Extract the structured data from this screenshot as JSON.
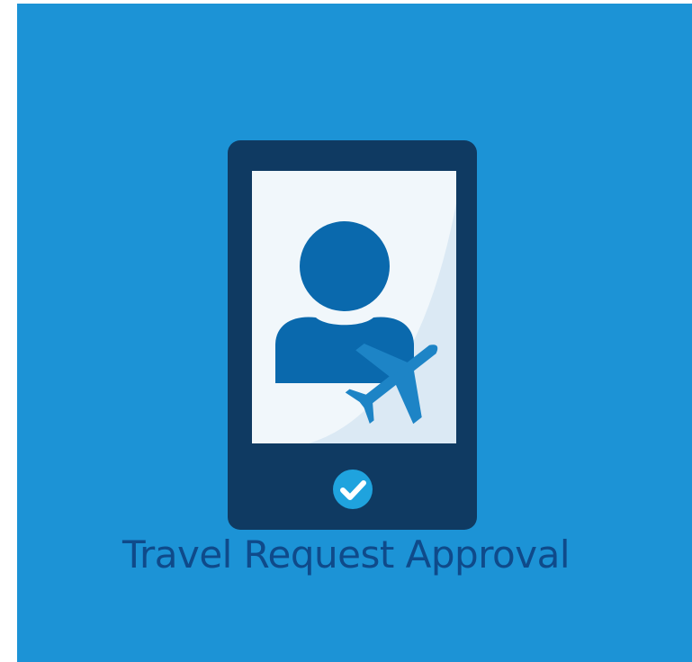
{
  "app": {
    "title": "Travel Request Approval"
  },
  "icons": {
    "device": "smartphone-icon",
    "user": "user-avatar-icon",
    "travel": "airplane-icon",
    "status": "checkmark-icon"
  },
  "colors": {
    "background": "#1c93d6",
    "phone_body": "#0f3a62",
    "screen": "#eef5fa",
    "accent": "#1d84c6",
    "title_text": "#0f4a8a"
  }
}
